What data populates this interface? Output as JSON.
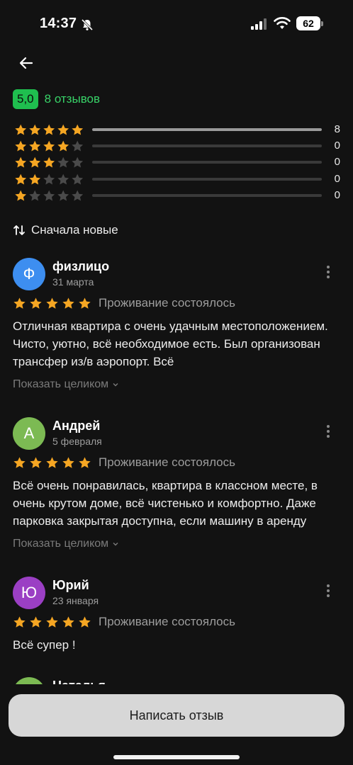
{
  "status_bar": {
    "time": "14:37",
    "battery": "62"
  },
  "summary": {
    "rating": "5,0",
    "reviews_count": "8 отзывов"
  },
  "histogram": [
    {
      "stars": 5,
      "count": "8",
      "fraction": 1.0
    },
    {
      "stars": 4,
      "count": "0",
      "fraction": 0
    },
    {
      "stars": 3,
      "count": "0",
      "fraction": 0
    },
    {
      "stars": 2,
      "count": "0",
      "fraction": 0
    },
    {
      "stars": 1,
      "count": "0",
      "fraction": 0
    }
  ],
  "sort": {
    "label": "Сначала новые",
    "icon": "sort-arrows-icon"
  },
  "reviews": [
    {
      "initial": "Ф",
      "avatar_color": "#3d8ef0",
      "author": "физлицо",
      "date": "31 марта",
      "rating": 5,
      "status": "Проживание состоялось",
      "text": "Отличная квартира с очень удачным местоположением. Чисто, уютно, всё необходимое есть. Был организован трансфер из/в аэропорт. Всё",
      "show_more": "Показать целиком"
    },
    {
      "initial": "А",
      "avatar_color": "#7cba53",
      "author": "Андрей",
      "date": "5 февраля",
      "rating": 5,
      "status": "Проживание состоялось",
      "text": "Всё очень понравилась, квартира в классном месте, в очень крутом доме, всё чистенько и комфортно. Даже парковка закрытая доступна, если машину в аренду",
      "show_more": "Показать целиком"
    },
    {
      "initial": "Ю",
      "avatar_color": "#9b3fc4",
      "author": "Юрий",
      "date": "23 января",
      "rating": 5,
      "status": "Проживание состоялось",
      "text": "Всё супер !"
    }
  ],
  "partial_review": {
    "author": "Наталья"
  },
  "write_review_label": "Написать отзыв",
  "colors": {
    "star_filled": "#f5a623",
    "star_empty": "#4a4a4a",
    "accent_green": "#1fbf4f"
  }
}
